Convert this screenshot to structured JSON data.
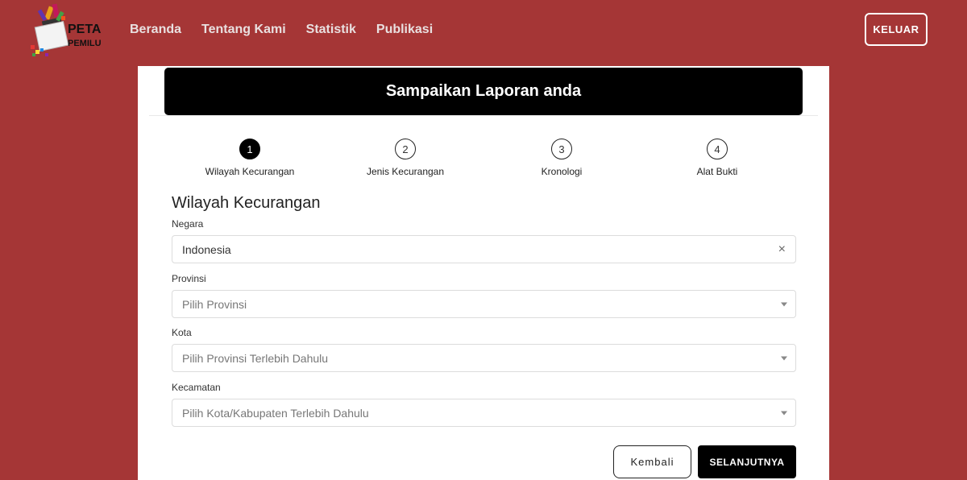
{
  "brand": {
    "line1": "PETA",
    "line2": "PEMILU"
  },
  "nav": {
    "items": [
      {
        "label": "Beranda"
      },
      {
        "label": "Tentang Kami"
      },
      {
        "label": "Statistik"
      },
      {
        "label": "Publikasi"
      }
    ],
    "logout_label": "KELUAR"
  },
  "card": {
    "title": "Sampaikan Laporan anda"
  },
  "steps": [
    {
      "number": "1",
      "label": "Wilayah Kecurangan",
      "active": true
    },
    {
      "number": "2",
      "label": "Jenis Kecurangan",
      "active": false
    },
    {
      "number": "3",
      "label": "Kronologi",
      "active": false
    },
    {
      "number": "4",
      "label": "Alat Bukti",
      "active": false
    }
  ],
  "form": {
    "section_title": "Wilayah Kecurangan",
    "negara": {
      "label": "Negara",
      "value": "Indonesia"
    },
    "provinsi": {
      "label": "Provinsi",
      "placeholder": "Pilih Provinsi"
    },
    "kota": {
      "label": "Kota",
      "placeholder": "Pilih Provinsi Terlebih Dahulu"
    },
    "kecamatan": {
      "label": "Kecamatan",
      "placeholder": "Pilih Kota/Kabupaten Terlebih Dahulu"
    },
    "back_label": "Kembali",
    "next_label": "SELANJUTNYA"
  },
  "colors": {
    "background": "#a53636",
    "accent": "#000000"
  }
}
